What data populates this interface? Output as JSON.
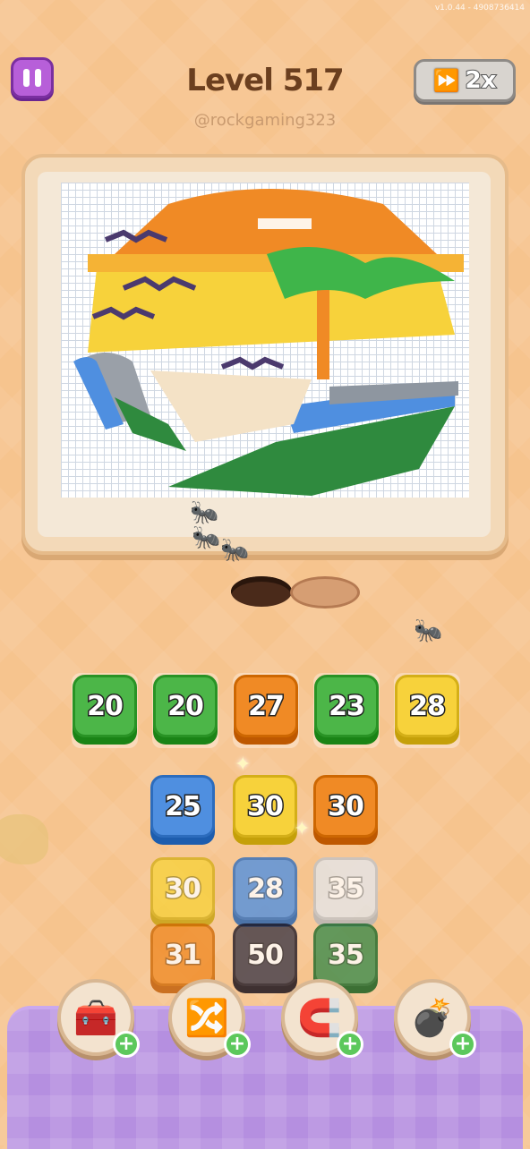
{
  "version": "v1.0.44 - 4908736414",
  "header": {
    "title": "Level 517",
    "username": "@rockgaming323",
    "speed_label": "2x"
  },
  "colors": {
    "pause": "#b75fd9",
    "green": "#4cb648",
    "orange": "#f08a25",
    "yellow": "#f7d23b",
    "blue": "#4f8fe0",
    "white": "#e4e6ea",
    "dark": "#3d3846",
    "darkgreen": "#3a8a4a",
    "panel": "#b58fe0"
  },
  "queue": [
    {
      "value": "20",
      "color": "green"
    },
    {
      "value": "20",
      "color": "green"
    },
    {
      "value": "27",
      "color": "orange"
    },
    {
      "value": "23",
      "color": "green"
    },
    {
      "value": "28",
      "color": "yellow"
    }
  ],
  "grid_rows": [
    [
      {
        "value": "25",
        "color": "blue"
      },
      {
        "value": "30",
        "color": "yellow"
      },
      {
        "value": "30",
        "color": "orange"
      }
    ],
    [
      {
        "value": "30",
        "color": "yellow"
      },
      {
        "value": "28",
        "color": "blue"
      },
      {
        "value": "35",
        "color": "white"
      }
    ],
    [
      {
        "value": "31",
        "color": "orange"
      },
      {
        "value": "50",
        "color": "dark"
      },
      {
        "value": "35",
        "color": "darkgreen"
      }
    ]
  ],
  "boosters": [
    {
      "name": "add-slot-booster",
      "icon": "box-plus-icon"
    },
    {
      "name": "shuffle-booster",
      "icon": "shuffle-arrows-icon"
    },
    {
      "name": "magnet-booster",
      "icon": "magnet-icon"
    },
    {
      "name": "bomb-booster",
      "icon": "bomb-icon"
    }
  ]
}
